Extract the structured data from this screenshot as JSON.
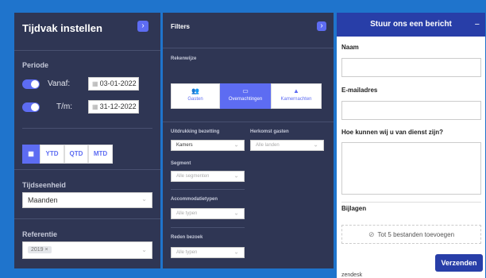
{
  "tijdvak": {
    "title": "Tijdvak instellen",
    "periode_label": "Periode",
    "from_label": "Vanaf:",
    "from_date": "03-01-2022",
    "to_label": "T/m:",
    "to_date": "31-12-2022",
    "periods": [
      "YTD",
      "QTD",
      "MTD"
    ],
    "tijdseenheid_label": "Tijdseenheid",
    "tijdseenheid_value": "Maanden",
    "referentie_label": "Referentie",
    "referentie_chip": "2019 ×"
  },
  "filters": {
    "title": "Filters",
    "rekenwijze_label": "Rekenwijze",
    "rekenwijze": [
      "Gasten",
      "Overnachtingen",
      "Kamernachten"
    ],
    "active_rekenwijze": "Overnachtingen",
    "uitdrukking_label": "Uitdrukking bezetting",
    "uitdrukking_value": "Kamers",
    "herkomst_label": "Herkomst gasten",
    "herkomst_placeholder": "Alle landen",
    "segment_label": "Segment",
    "segment_placeholder": "Alle segmenten",
    "accommodatie_label": "Accommodatietypen",
    "accommodatie_placeholder": "Alle typen",
    "reden_label": "Reden bezoek",
    "reden_placeholder": "Alle typen"
  },
  "chat": {
    "title": "Stuur ons een bericht",
    "minimize": "−",
    "name_label": "Naam",
    "email_label": "E-mailadres",
    "question_label": "Hoe kunnen wij u van dienst zijn?",
    "attachments_label": "Bijlagen",
    "attach_text": "Tot 5 bestanden toevoegen",
    "brand": "zendesk",
    "send_label": "Verzenden"
  },
  "colors": {
    "accent": "#5d6cf2",
    "panel": "#2f3654",
    "chat_brand": "#283ea8",
    "background": "#1f74cc"
  }
}
